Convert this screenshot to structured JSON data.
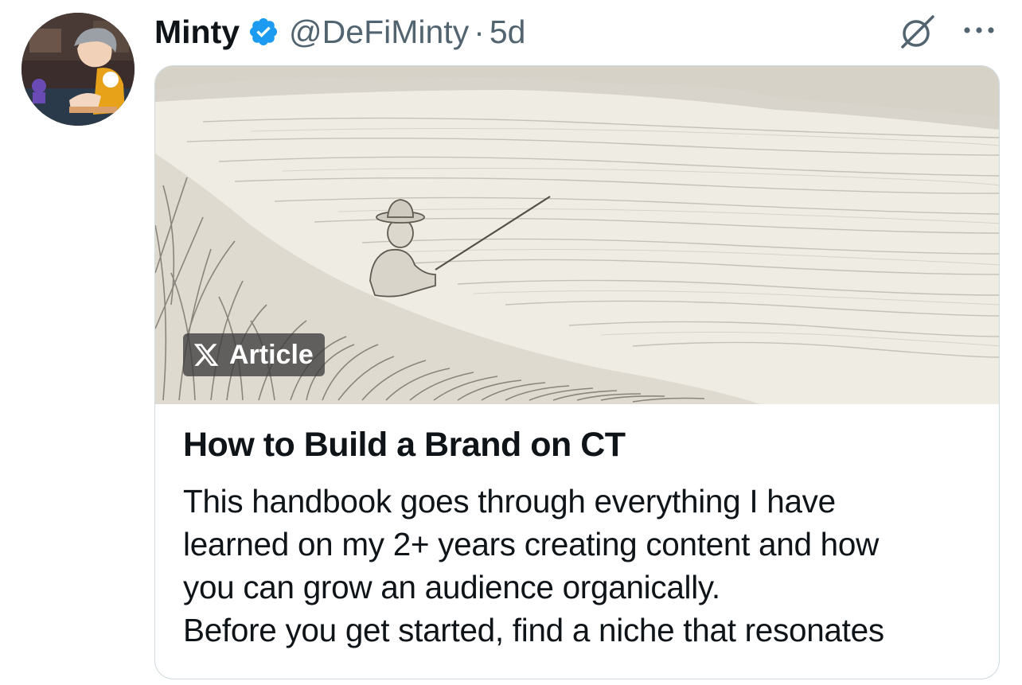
{
  "tweet": {
    "author_name": "Minty",
    "handle": "@DeFiMinty",
    "separator": "·",
    "time_ago": "5d",
    "verified": true,
    "icons": {
      "avatar": "profile-avatar",
      "verified": "verified-badge-icon",
      "grok": "grok-icon",
      "more": "more-options-icon"
    }
  },
  "article_card": {
    "badge_label": "Article",
    "badge_icon": "x-logo-icon",
    "image_description_icon": "pencil-sketch-fisherman-by-lake",
    "title": "How to Build a Brand on CT",
    "description_lines": [
      "This handbook goes through everything I have",
      "learned on my 2+ years creating content and how",
      "you can grow an audience organically.",
      "Before you get started, find a niche that resonates"
    ]
  },
  "colors": {
    "text_primary": "#0f1419",
    "text_secondary": "#536471",
    "verified_blue": "#1d9bf0",
    "border": "#cfd9de"
  }
}
